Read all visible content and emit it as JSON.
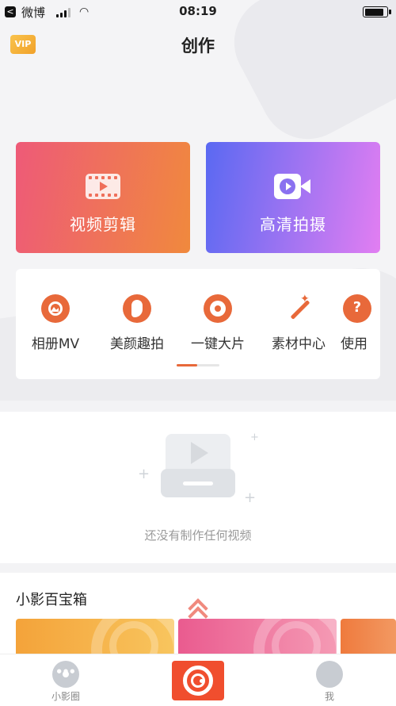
{
  "status_bar": {
    "back_glyph": "<",
    "carrier": "微博",
    "time": "08:19",
    "battery_level": 0.95
  },
  "header": {
    "vip_badge": "VIP",
    "title": "创作"
  },
  "cards": [
    {
      "label": "视频剪辑",
      "icon": "film-play-icon"
    },
    {
      "label": "高清拍摄",
      "icon": "video-camera-icon"
    }
  ],
  "tools": [
    {
      "label": "相册MV",
      "icon": "album-mv-icon"
    },
    {
      "label": "美颜趣拍",
      "icon": "beauty-icon"
    },
    {
      "label": "一键大片",
      "icon": "film-reel-icon"
    },
    {
      "label": "素材中心",
      "icon": "magic-wand-icon"
    },
    {
      "label": "使用",
      "icon": "help-icon"
    }
  ],
  "empty_state": {
    "message": "还没有制作任何视频"
  },
  "toolbox": {
    "title": "小影百宝箱"
  },
  "tabbar": {
    "items": [
      {
        "label": "小影圈",
        "icon": "film-reel-icon"
      },
      {
        "label": "",
        "icon": "camera-lens-icon"
      },
      {
        "label": "我",
        "icon": "profile-icon"
      }
    ]
  },
  "colors": {
    "accent": "#e8693a",
    "record_button": "#f04e2e",
    "vip": "#f1a12a"
  }
}
